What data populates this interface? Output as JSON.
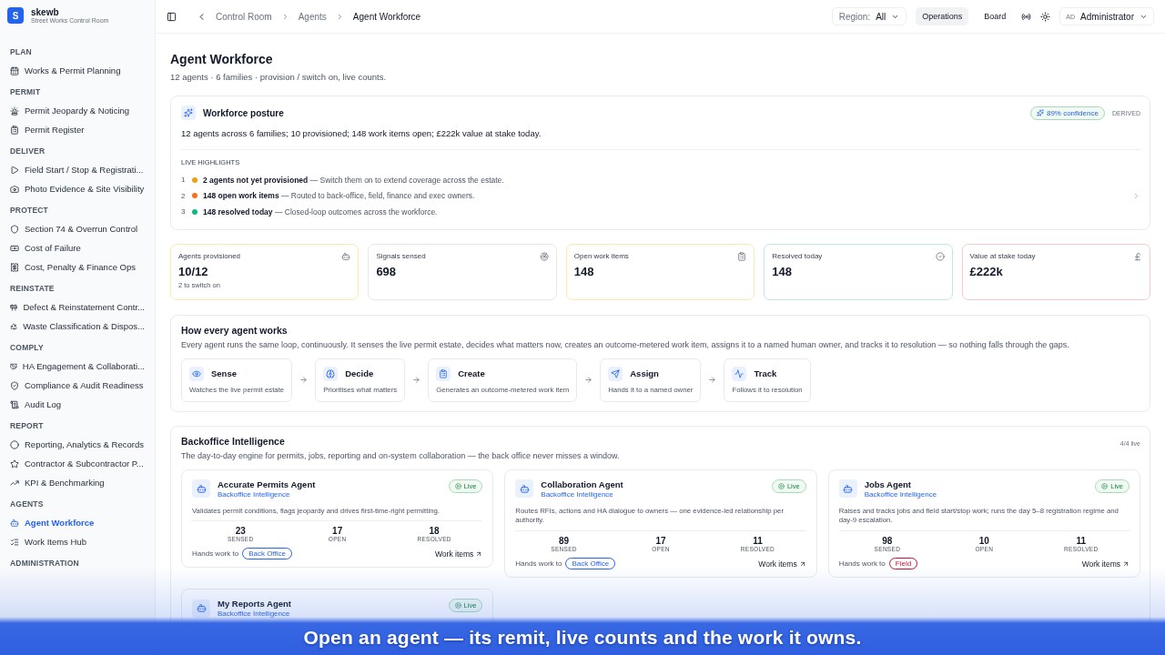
{
  "brand": {
    "logo": "S",
    "name": "skewb",
    "tagline": "Street Works Control Room"
  },
  "sidebar": {
    "sections": [
      {
        "title": "PLAN",
        "items": [
          {
            "label": "Works & Permit Planning",
            "selected": false
          }
        ]
      },
      {
        "title": "PERMIT",
        "items": [
          {
            "label": "Permit Jeopardy & Noticing",
            "selected": false
          },
          {
            "label": "Permit Register",
            "selected": false
          }
        ]
      },
      {
        "title": "DELIVER",
        "items": [
          {
            "label": "Field Start / Stop & Registrati...",
            "selected": false
          },
          {
            "label": "Photo Evidence & Site Visibility",
            "selected": false
          }
        ]
      },
      {
        "title": "PROTECT",
        "items": [
          {
            "label": "Section 74 & Overrun Control",
            "selected": false
          },
          {
            "label": "Cost of Failure",
            "selected": false
          },
          {
            "label": "Cost, Penalty & Finance Ops",
            "selected": false
          }
        ]
      },
      {
        "title": "REINSTATE",
        "items": [
          {
            "label": "Defect & Reinstatement Contr...",
            "selected": false
          },
          {
            "label": "Waste Classification & Dispos...",
            "selected": false
          }
        ]
      },
      {
        "title": "COMPLY",
        "items": [
          {
            "label": "HA Engagement & Collaborati...",
            "selected": false
          },
          {
            "label": "Compliance & Audit Readiness",
            "selected": false
          },
          {
            "label": "Audit Log",
            "selected": false
          }
        ]
      },
      {
        "title": "REPORT",
        "items": [
          {
            "label": "Reporting, Analytics & Records",
            "selected": false
          },
          {
            "label": "Contractor & Subcontractor P...",
            "selected": false
          },
          {
            "label": "KPI & Benchmarking",
            "selected": false
          }
        ]
      },
      {
        "title": "AGENTS",
        "items": [
          {
            "label": "Agent Workforce",
            "selected": true
          },
          {
            "label": "Work Items Hub",
            "selected": false
          }
        ]
      },
      {
        "title": "ADMINISTRATION"
      }
    ]
  },
  "topbar": {
    "breadcrumbs": [
      "Control Room",
      "Agents",
      "Agent Workforce"
    ],
    "region_label": "Region:",
    "region_value": "All",
    "buttons": [
      {
        "label": "Operations",
        "selected": true
      },
      {
        "label": "Board",
        "selected": false
      }
    ],
    "user_initials": "AD",
    "user_name": "Administrator"
  },
  "page": {
    "title": "Agent Workforce",
    "subtitle": "12 agents · 6 families · provision / switch on, live counts."
  },
  "posture": {
    "title": "Workforce posture",
    "confidence": "89% confidence",
    "derived": "DERIVED",
    "summary": "12 agents across 6 families; 10 provisioned; 148 work items open; £222k value at stake today.",
    "highlights_title": "LIVE HIGHLIGHTS",
    "highlights": [
      {
        "index": "1",
        "color": "#f59e0b",
        "text": "**2 agents not yet provisioned** — Switch them on to extend coverage across the estate."
      },
      {
        "index": "2",
        "color": "#f97316",
        "text": "**148 open work items** — Routed to back-office, field, finance and exec owners."
      },
      {
        "index": "3",
        "color": "#10b981",
        "text": "**148 resolved today** — Closed-loop outcomes across the workforce."
      }
    ]
  },
  "metrics": [
    {
      "label": "Agents provisioned",
      "value": "10/12",
      "note": "2 to switch on",
      "color": "#fde9b0",
      "kind": "bot"
    },
    {
      "label": "Signals sensed",
      "value": "698",
      "color": "#e5e7eb",
      "kind": "radar"
    },
    {
      "label": "Open work items",
      "value": "148",
      "color": "#fde9b0",
      "kind": "clipboard"
    },
    {
      "label": "Resolved today",
      "value": "148",
      "color": "#bfe8e6",
      "kind": "check"
    },
    {
      "label": "Value at stake today",
      "value": "£222k",
      "color": "#f6c9cf",
      "kind": "pound"
    }
  ],
  "loop": {
    "title": "How every agent works",
    "description": "Every agent runs the same loop, continuously. It senses the live permit estate, decides what matters now, creates an outcome-metered work item, assigns it to a named human owner, and tracks it to resolution — so nothing falls through the gaps.",
    "steps": [
      {
        "kind": "eye",
        "title": "Sense",
        "text": "Watches the live permit estate"
      },
      {
        "kind": "brain",
        "title": "Decide",
        "text": "Prioritises what matters"
      },
      {
        "kind": "clipboard",
        "title": "Create",
        "text": "Generates an outcome-metered work item"
      },
      {
        "kind": "send",
        "title": "Assign",
        "text": "Hands it to a named owner"
      },
      {
        "kind": "pulse",
        "title": "Track",
        "text": "Follows it to resolution"
      }
    ]
  },
  "family": {
    "title": "Backoffice Intelligence",
    "count": "4/4 live",
    "description": "The day-to-day engine for permits, jobs, reporting and on-system collaboration — the back office never misses a window.",
    "agents": [
      {
        "name": "Accurate Permits Agent",
        "family": "Backoffice Intelligence",
        "status": "Live",
        "description": "Validates permit conditions, flags jeopardy and drives first-time-right permitting.",
        "stats": [
          {
            "value": "23",
            "label": "SENSED"
          },
          {
            "value": "17",
            "label": "OPEN"
          },
          {
            "value": "18",
            "label": "RESOLVED"
          }
        ],
        "hands_label": "Hands work to",
        "owner": "Back Office",
        "color": "#2563eb",
        "link": "Work items"
      },
      {
        "name": "Collaboration Agent",
        "family": "Backoffice Intelligence",
        "status": "Live",
        "description": "Routes RFIs, actions and HA dialogue to owners — one evidence-led relationship per authority.",
        "stats": [
          {
            "value": "89",
            "label": "SENSED"
          },
          {
            "value": "17",
            "label": "OPEN"
          },
          {
            "value": "11",
            "label": "RESOLVED"
          }
        ],
        "hands_label": "Hands work to",
        "owner": "Back Office",
        "color": "#2563eb",
        "link": "Work items"
      },
      {
        "name": "Jobs Agent",
        "family": "Backoffice Intelligence",
        "status": "Live",
        "description": "Raises and tracks jobs and field start/stop work; runs the day 5–8 registration regime and day-9 escalation.",
        "stats": [
          {
            "value": "98",
            "label": "SENSED"
          },
          {
            "value": "10",
            "label": "OPEN"
          },
          {
            "value": "11",
            "label": "RESOLVED"
          }
        ],
        "hands_label": "Hands work to",
        "owner": "Field",
        "color": "#be123c",
        "link": "Work items"
      },
      {
        "name": "My Reports Agent",
        "family": "Backoffice Intelligence",
        "status": "Live"
      }
    ]
  },
  "caption": "Open an agent — its remit, live counts and the work it owns."
}
